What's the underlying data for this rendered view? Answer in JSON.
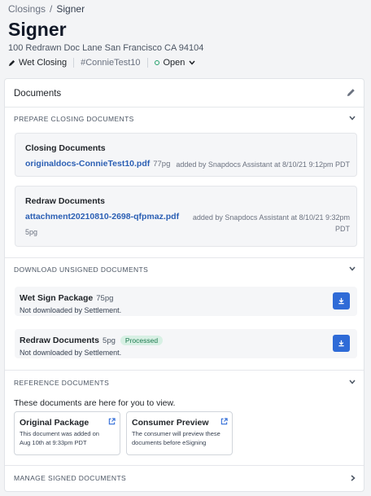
{
  "breadcrumb": {
    "parent": "Closings",
    "separator": "/",
    "current": "Signer"
  },
  "header": {
    "title": "Signer",
    "address": "100 Redrawn Doc Lane San Francisco CA 94104",
    "closing_type": "Wet Closing",
    "tag": "#ConnieTest10",
    "status": "Open"
  },
  "documents_card": {
    "title": "Documents",
    "prepare": {
      "label": "PREPARE CLOSING DOCUMENTS",
      "items": [
        {
          "title": "Closing Documents",
          "file": "originaldocs-ConnieTest10.pdf",
          "pages": "77pg",
          "added_by": "added by Snapdocs Assistant at 8/10/21 9:12pm PDT"
        },
        {
          "title": "Redraw Documents",
          "file": "attachment20210810-2698-qfpmaz.pdf",
          "pages": "5pg",
          "added_by_line1": "added by Snapdocs Assistant at 8/10/21 9:32pm",
          "added_by_line2": "PDT"
        }
      ]
    },
    "download": {
      "label": "DOWNLOAD UNSIGNED DOCUMENTS",
      "items": [
        {
          "title": "Wet Sign Package",
          "pages": "75pg",
          "status": "Not downloaded by Settlement."
        },
        {
          "title": "Redraw Documents",
          "pages": "5pg",
          "badge": "Processed",
          "status": "Not downloaded by Settlement."
        }
      ]
    },
    "reference": {
      "label": "REFERENCE DOCUMENTS",
      "note": "These documents are here for you to view.",
      "cards": [
        {
          "title": "Original Package",
          "desc": "This document was added on Aug 10th at 9:33pm PDT"
        },
        {
          "title": "Consumer Preview",
          "desc": "The consumer will preview these documents before eSigning"
        }
      ]
    },
    "manage": {
      "label": "MANAGE SIGNED DOCUMENTS"
    }
  },
  "colors": {
    "accent": "#2f6bd7",
    "link": "#2b5fb4",
    "status_green": "#22a06b",
    "badge_bg": "#d7f0e4"
  },
  "icons": [
    "pen-icon",
    "edit-pencil-icon",
    "chevron-down-icon",
    "chevron-right-icon",
    "download-icon",
    "external-link-icon"
  ]
}
